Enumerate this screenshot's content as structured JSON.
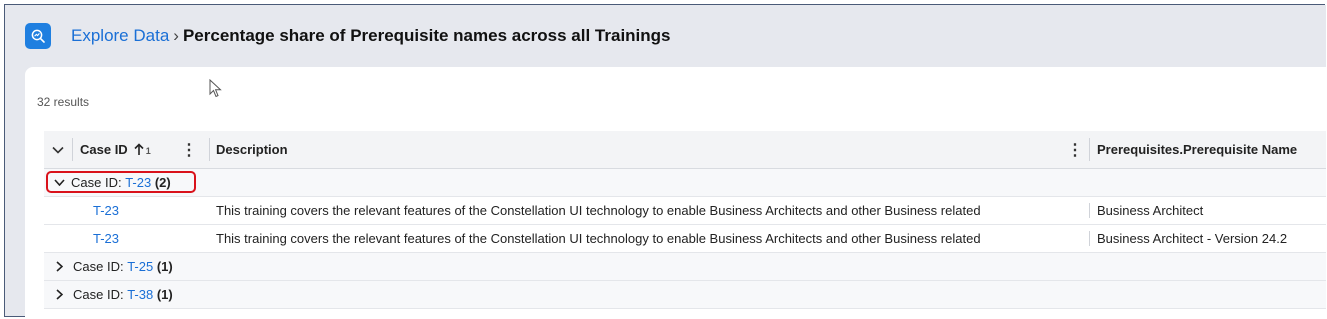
{
  "header": {
    "breadcrumb_link": "Explore Data",
    "separator": "›",
    "title": "Percentage share of Prerequisite names across all Trainings"
  },
  "results_count": "32 results",
  "table": {
    "columns": {
      "case_id": "Case ID",
      "sort_index": "1",
      "description": "Description",
      "prereq": "Prerequisites.Prerequisite Name"
    },
    "groups": [
      {
        "label": "Case ID:",
        "value": "T-23",
        "count": "(2)",
        "expanded": true,
        "rows": [
          {
            "case_id": "T-23",
            "description": "This training covers the relevant features of the Constellation UI technology to enable Business Architects and other Business related",
            "prereq": "Business Architect"
          },
          {
            "case_id": "T-23",
            "description": "This training covers the relevant features of the Constellation UI technology to enable Business Architects and other Business related",
            "prereq": "Business Architect - Version 24.2"
          }
        ]
      },
      {
        "label": "Case ID:",
        "value": "T-25",
        "count": "(1)",
        "expanded": false
      },
      {
        "label": "Case ID:",
        "value": "T-38",
        "count": "(1)",
        "expanded": false
      }
    ]
  },
  "colors": {
    "accent": "#1a6fd6",
    "highlight": "#d9121b",
    "app_icon": "#1f7fe0"
  }
}
